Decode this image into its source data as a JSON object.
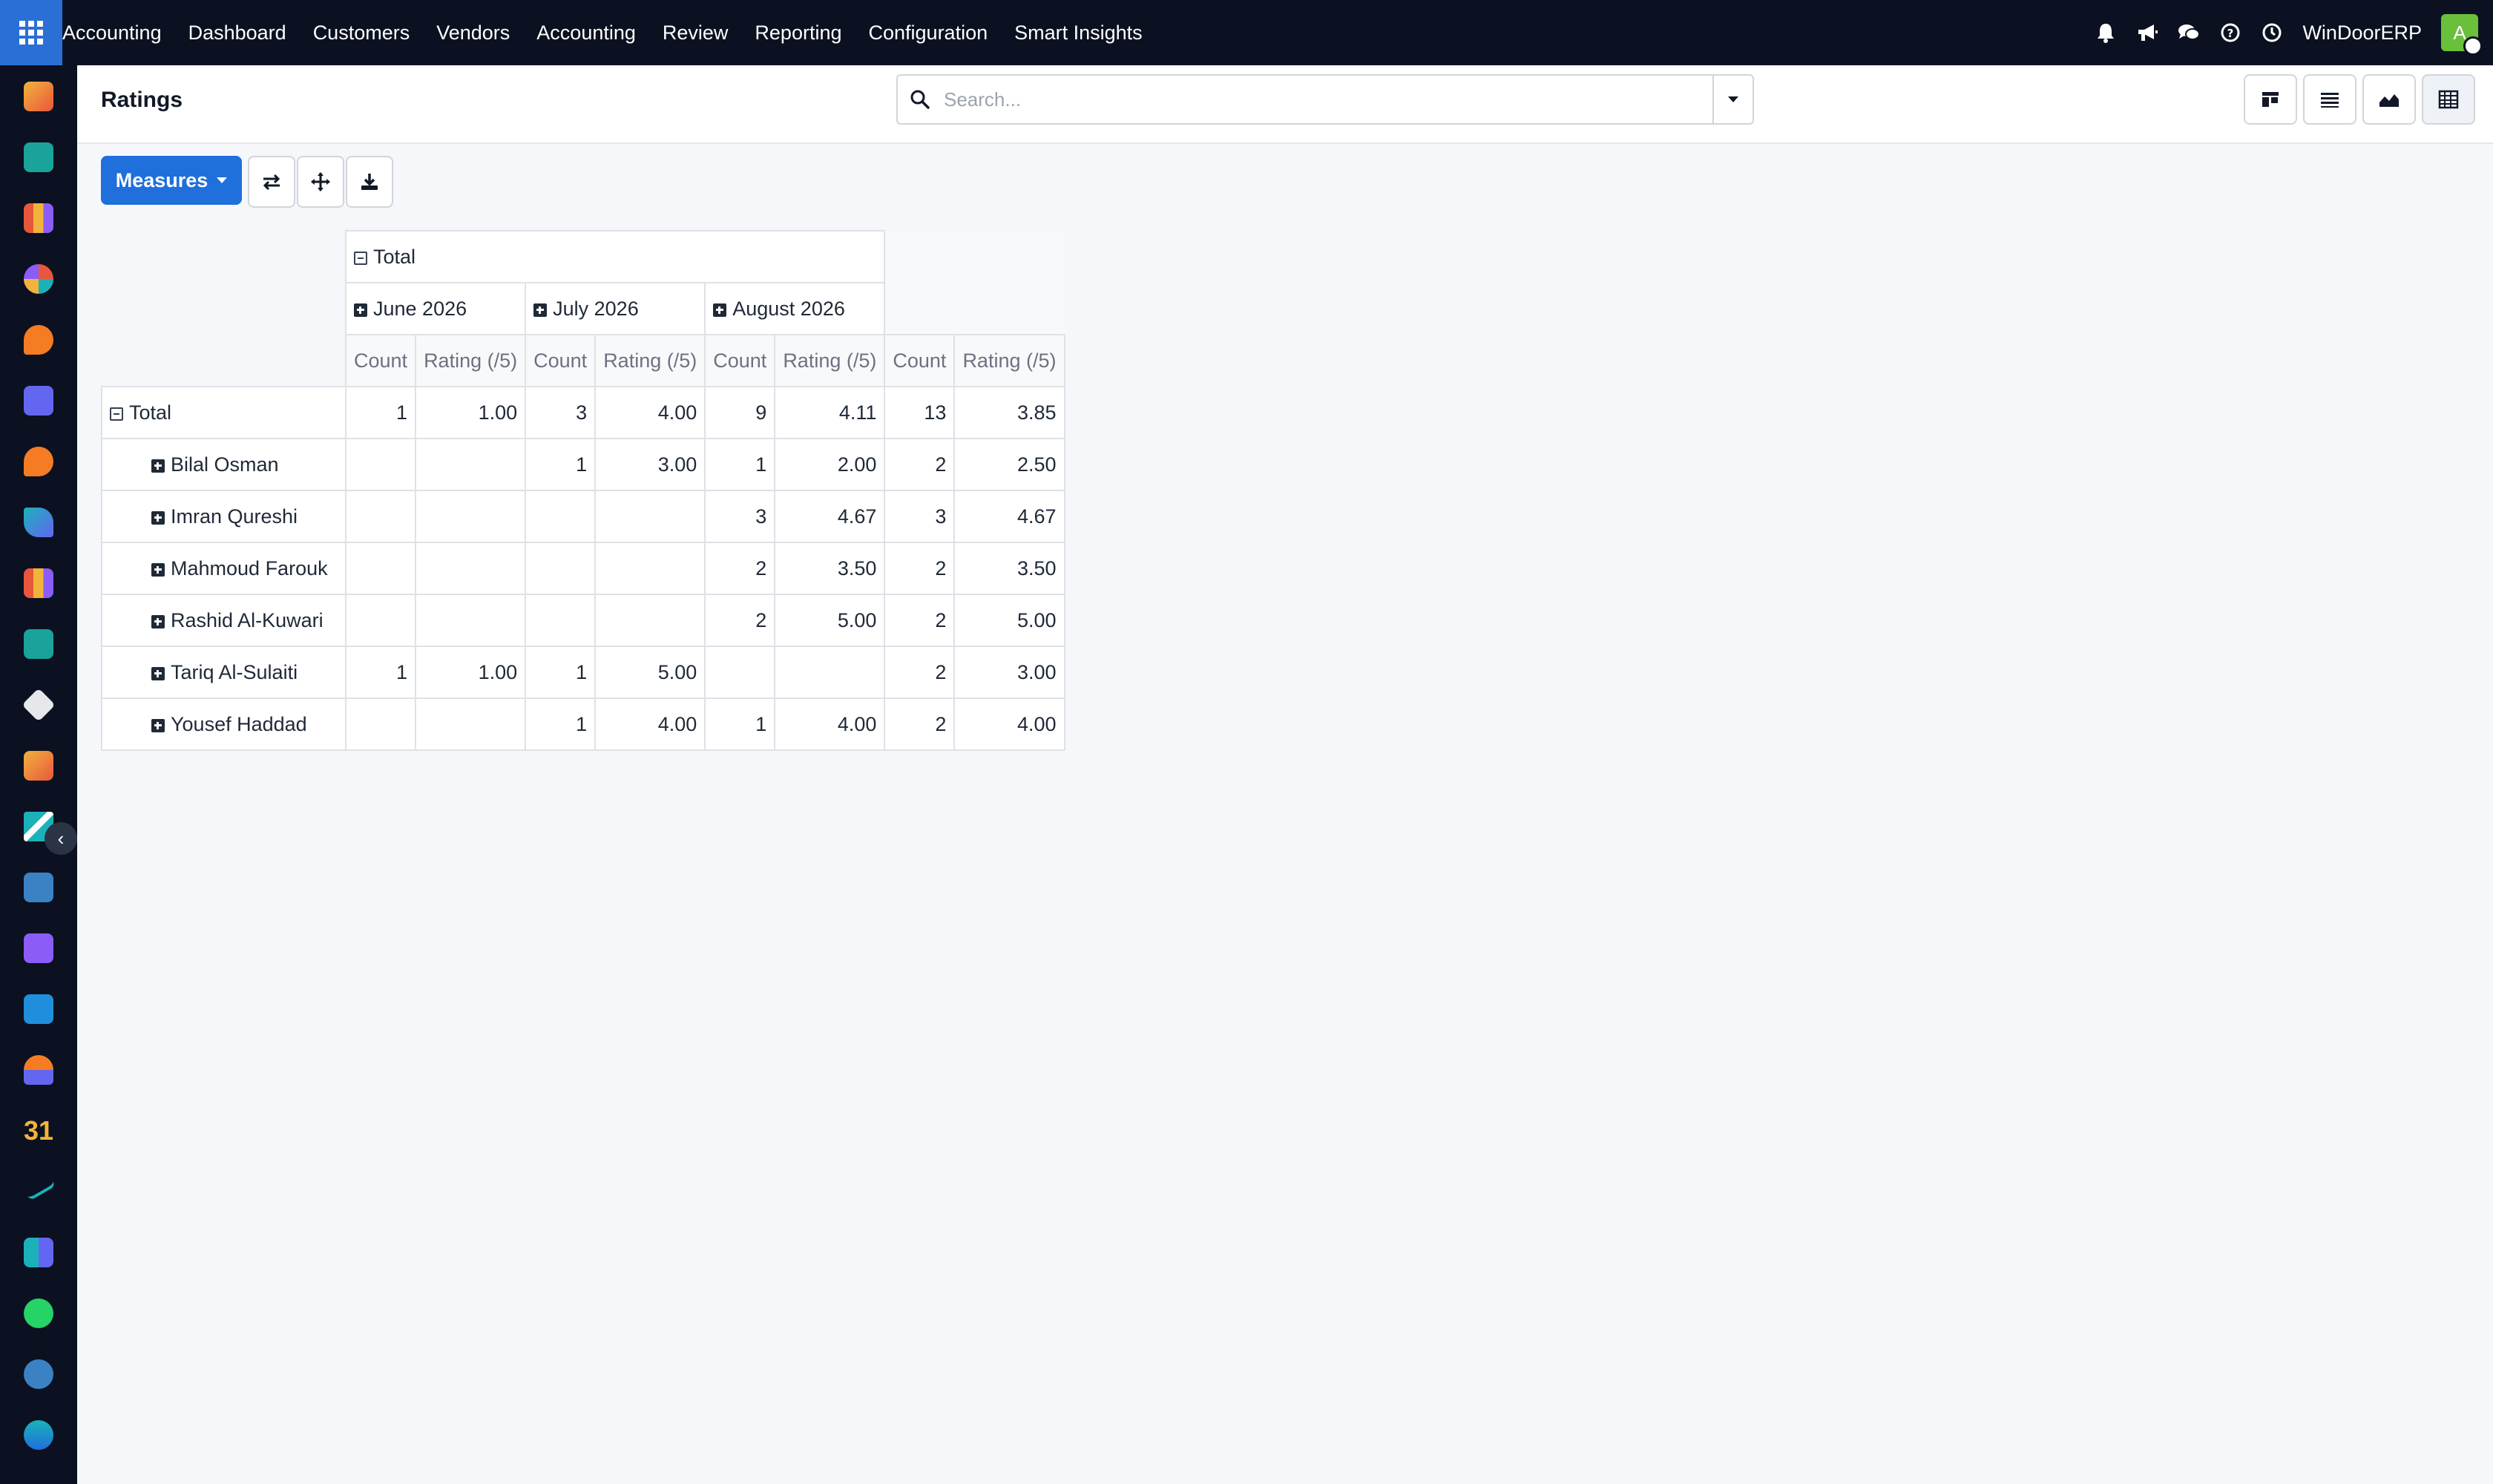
{
  "topbar": {
    "brand": "Accounting",
    "menu": [
      "Dashboard",
      "Customers",
      "Vendors",
      "Accounting",
      "Review",
      "Reporting",
      "Configuration",
      "Smart Insights"
    ],
    "company": "WinDoorERP",
    "avatar_initial": "A",
    "icons": [
      "bell-icon",
      "megaphone-icon",
      "chat-icon",
      "help-icon",
      "clock-icon"
    ]
  },
  "sidebar": {
    "apps": [
      "apps-1",
      "contacts",
      "reporting",
      "dashboards",
      "discuss",
      "email-marketing",
      "live-chat",
      "documents",
      "reporting-2",
      "contacts-2",
      "inventory",
      "apps-2",
      "todo",
      "knowledge",
      "product",
      "invoicing",
      "employees",
      "calendar",
      "sign",
      "spreadsheet",
      "whatsapp",
      "timer",
      "social"
    ],
    "calendar_label": "31"
  },
  "control": {
    "title": "Ratings",
    "search_placeholder": "Search...",
    "search_value": ""
  },
  "toolbar": {
    "measures_label": "Measures"
  },
  "pivot": {
    "col_total_label": "Total",
    "months": [
      "June 2026",
      "July 2026",
      "August 2026"
    ],
    "measures": [
      "Count",
      "Rating (/5)"
    ],
    "rows": [
      {
        "label": "Total",
        "cells": [
          "1",
          "1.00",
          "3",
          "4.00",
          "9",
          "4.11",
          "13",
          "3.85"
        ]
      },
      {
        "label": "Bilal Osman",
        "cells": [
          "",
          "",
          "1",
          "3.00",
          "1",
          "2.00",
          "2",
          "2.50"
        ]
      },
      {
        "label": "Imran Qureshi",
        "cells": [
          "",
          "",
          "",
          "",
          "3",
          "4.67",
          "3",
          "4.67"
        ]
      },
      {
        "label": "Mahmoud Farouk",
        "cells": [
          "",
          "",
          "",
          "",
          "2",
          "3.50",
          "2",
          "3.50"
        ]
      },
      {
        "label": "Rashid Al-Kuwari",
        "cells": [
          "",
          "",
          "",
          "",
          "2",
          "5.00",
          "2",
          "5.00"
        ]
      },
      {
        "label": "Tariq Al-Sulaiti",
        "cells": [
          "1",
          "1.00",
          "1",
          "5.00",
          "",
          "",
          "2",
          "3.00"
        ]
      },
      {
        "label": "Yousef Haddad",
        "cells": [
          "",
          "",
          "1",
          "4.00",
          "1",
          "4.00",
          "2",
          "4.00"
        ]
      }
    ]
  }
}
